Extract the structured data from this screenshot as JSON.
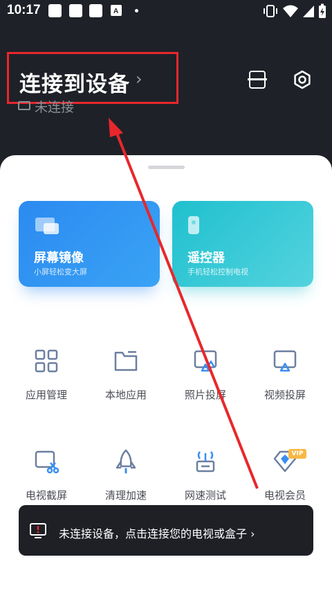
{
  "statusbar": {
    "time": "10:17"
  },
  "header": {
    "title": "连接到设备",
    "chevron": "›",
    "connection_status": "未连接"
  },
  "cards": [
    {
      "title": "屏幕镜像",
      "subtitle": "小屏轻松变大屏",
      "icon": "screen-mirror-icon"
    },
    {
      "title": "遥控器",
      "subtitle": "手机轻松控制电视",
      "icon": "remote-icon"
    }
  ],
  "grid": [
    {
      "label": "应用管理",
      "icon": "apps-grid-icon"
    },
    {
      "label": "本地应用",
      "icon": "folder-icon"
    },
    {
      "label": "照片投屏",
      "icon": "photo-cast-icon"
    },
    {
      "label": "视频投屏",
      "icon": "video-cast-icon"
    },
    {
      "label": "电视截屏",
      "icon": "screenshot-icon"
    },
    {
      "label": "清理加速",
      "icon": "rocket-icon"
    },
    {
      "label": "网速测试",
      "icon": "router-icon"
    },
    {
      "label": "电视会员",
      "icon": "vip-diamond-icon",
      "badge": "VIP"
    }
  ],
  "toast": {
    "text": "未连接设备，点击连接您的电视或盒子 ›"
  },
  "colors": {
    "accent_blue": "#2b8af0",
    "accent_teal": "#20c0cf",
    "highlight_red": "#e8272c",
    "dark_bg": "#1f2128"
  }
}
